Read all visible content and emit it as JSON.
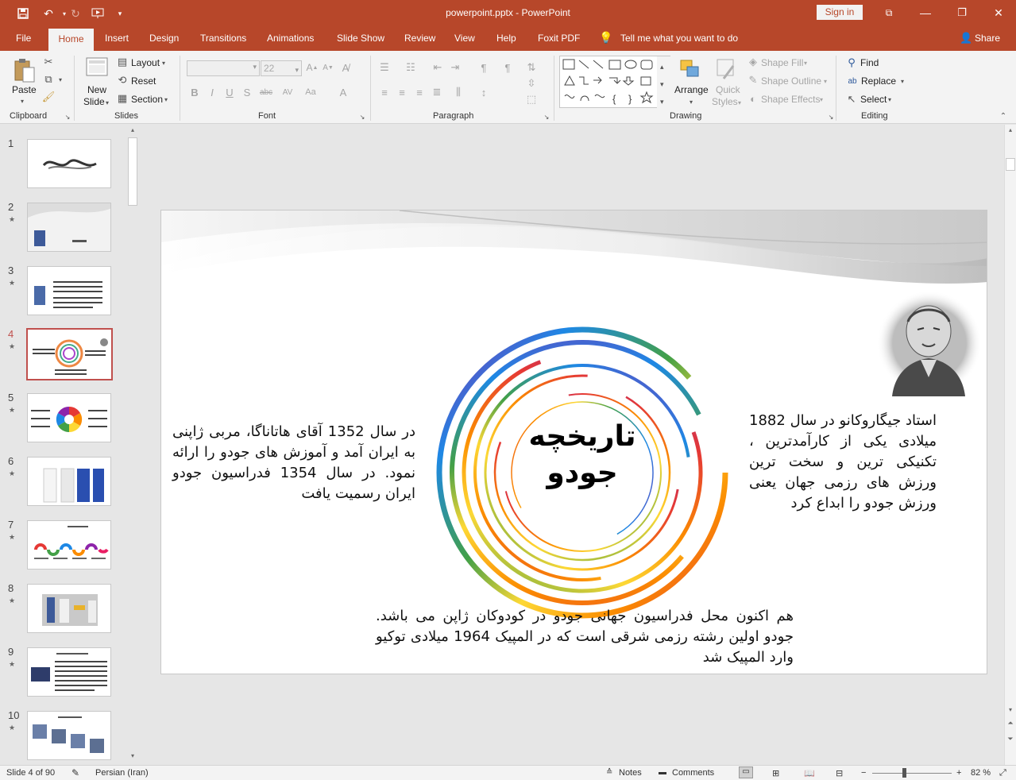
{
  "app": {
    "doc_title": "powerpoint.pptx - PowerPoint",
    "sign_in": "Sign in"
  },
  "tabs": [
    "File",
    "Home",
    "Insert",
    "Design",
    "Transitions",
    "Animations",
    "Slide Show",
    "Review",
    "View",
    "Help",
    "Foxit PDF"
  ],
  "tell_me": "Tell me what you want to do",
  "share": "Share",
  "ribbon": {
    "clipboard": {
      "paste": "Paste",
      "label": "Clipboard"
    },
    "slides": {
      "new_slide_1": "New",
      "new_slide_2": "Slide",
      "layout": "Layout",
      "reset": "Reset",
      "section": "Section",
      "label": "Slides"
    },
    "font": {
      "font_name": "",
      "font_size": "22",
      "label": "Font"
    },
    "paragraph": {
      "label": "Paragraph"
    },
    "drawing": {
      "arrange": "Arrange",
      "quick_styles_1": "Quick",
      "quick_styles_2": "Styles",
      "shape_fill": "Shape Fill",
      "shape_outline": "Shape Outline",
      "shape_effects": "Shape Effects",
      "label": "Drawing"
    },
    "editing": {
      "find": "Find",
      "replace": "Replace",
      "select": "Select",
      "label": "Editing"
    }
  },
  "thumbnails": [
    {
      "num": "1",
      "star": ""
    },
    {
      "num": "2",
      "star": "★"
    },
    {
      "num": "3",
      "star": "★"
    },
    {
      "num": "4",
      "star": "★"
    },
    {
      "num": "5",
      "star": "★"
    },
    {
      "num": "6",
      "star": "★"
    },
    {
      "num": "7",
      "star": "★"
    },
    {
      "num": "8",
      "star": "★"
    },
    {
      "num": "9",
      "star": "★"
    },
    {
      "num": "10",
      "star": "★"
    }
  ],
  "slide": {
    "title_line1": "تاریخچه",
    "title_line2": "جودو",
    "left_text": "در سال 1352 آقای هاتاناگا، مربی ژاپنی به ایران آمد و آموزش های جودو را ارائه نمود. در سال 1354 فدراسیون جودو ایران رسمیت یافت",
    "right_text": "استاد جیگاروکانو در سال 1882 میلادی یکی از کارآمدترین ، تکنیکی ترین و سخت ترین ورزش های رزمی جهان یعنی ورزش جودو را ابداع کرد",
    "bottom_text": "هم اکنون محل فدراسیون جهانی جودو در کودوکان ژاپن می باشد. جودو اولین رشته رزمی شرقی است که در المپیک 1964 میلادی توکیو وارد المپیک شد"
  },
  "status": {
    "slide_info": "Slide 4 of 90",
    "language": "Persian (Iran)",
    "notes": "Notes",
    "comments": "Comments",
    "zoom": "82 %"
  }
}
